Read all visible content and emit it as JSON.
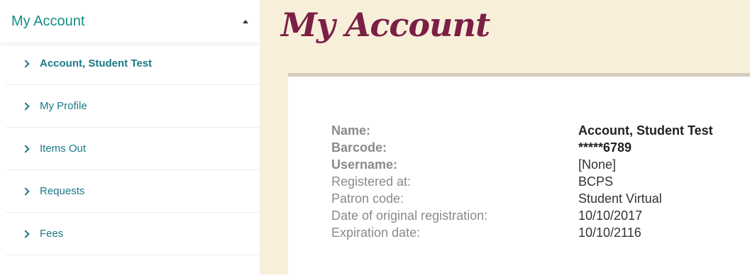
{
  "sidebar": {
    "header_label": "My Account",
    "items": [
      {
        "label": "Account, Student Test",
        "active": true
      },
      {
        "label": "My Profile",
        "active": false
      },
      {
        "label": "Items Out",
        "active": false
      },
      {
        "label": "Requests",
        "active": false
      },
      {
        "label": "Fees",
        "active": false
      }
    ]
  },
  "main": {
    "title": "My Account",
    "info": [
      {
        "label": "Name:",
        "value": "Account, Student Test"
      },
      {
        "label": "Barcode:",
        "value": "*****6789"
      },
      {
        "label": "Username:",
        "value": "[None]"
      },
      {
        "label": "Registered at:",
        "value": "BCPS"
      },
      {
        "label": "Patron code:",
        "value": "Student Virtual"
      },
      {
        "label": "Date of original registration:",
        "value": "10/10/2017"
      },
      {
        "label": "Expiration date:",
        "value": "10/10/2116"
      }
    ]
  },
  "colors": {
    "accent": "#138f86",
    "title": "#7b1f45",
    "background": "#f8efdb"
  }
}
